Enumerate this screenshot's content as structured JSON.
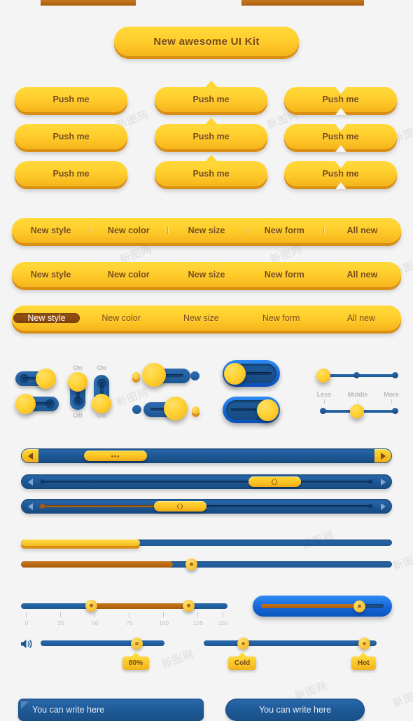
{
  "title": {
    "label": "New awesome UI Kit"
  },
  "push_buttons": {
    "label": "Push me",
    "rows": [
      [
        {
          "label": "Push me",
          "style": "plain"
        },
        {
          "label": "Push me",
          "style": "notch-top"
        },
        {
          "label": "Push me",
          "style": "split"
        }
      ],
      [
        {
          "label": "Push me",
          "style": "plain"
        },
        {
          "label": "Push me",
          "style": "notch-top"
        },
        {
          "label": "Push me",
          "style": "split"
        }
      ],
      [
        {
          "label": "Push me",
          "style": "plain"
        },
        {
          "label": "Push me",
          "style": "notch-top"
        },
        {
          "label": "Push me",
          "style": "split"
        }
      ]
    ]
  },
  "tabbars": [
    {
      "style": "divided",
      "tabs": [
        "New style",
        "New color",
        "New size",
        "New form",
        "All new"
      ],
      "active": -1
    },
    {
      "style": "dots",
      "tabs": [
        "New style",
        "New color",
        "New size",
        "New form",
        "All new"
      ],
      "active": -1
    },
    {
      "style": "pill",
      "tabs": [
        "New style",
        "New color",
        "New size",
        "New form",
        "All new"
      ],
      "active": 0
    }
  ],
  "toggles": {
    "vertical_labels": {
      "on": "On",
      "off": "Off"
    },
    "horizontal": [
      {
        "state": "on"
      },
      {
        "state": "off"
      }
    ],
    "vertical": [
      {
        "state": "up",
        "on": "On",
        "off": "Off"
      },
      {
        "state": "down",
        "on": "On",
        "off": "Off"
      }
    ],
    "dotted": [
      {
        "state": "on"
      },
      {
        "state": "off"
      }
    ],
    "capsule": [
      {
        "state": "off"
      },
      {
        "state": "on"
      }
    ]
  },
  "step_sliders": [
    {
      "labels": [
        "Less",
        "Middle",
        "More"
      ],
      "position": 0,
      "show_labels": false
    },
    {
      "labels": [
        "Less",
        "Middle",
        "More"
      ],
      "position": 1,
      "show_labels": true
    }
  ],
  "scrollbars": [
    {
      "arrow_left": "◀",
      "arrow_right": "▶",
      "thumb_glyph": "•••",
      "thumb_percent": 13,
      "thumb_width": 90,
      "ends": "gold"
    },
    {
      "arrow_left": "◁",
      "arrow_right": "▷",
      "thumb_glyph": "〈〉",
      "thumb_percent": 62,
      "thumb_width": 75,
      "ends": "flat",
      "filled": false
    },
    {
      "arrow_left": "◁",
      "arrow_right": "▷",
      "thumb_glyph": "〈〉",
      "thumb_percent": 36,
      "thumb_width": 75,
      "ends": "flat",
      "filled": true
    }
  ],
  "progress_bars": [
    {
      "percent": 32,
      "color": "#f3bb22",
      "knob": false
    },
    {
      "percent": 41,
      "color": "#a85c0d",
      "knob": true
    }
  ],
  "ruler_slider": {
    "ticks": [
      "0",
      "25",
      "50",
      "75",
      "100",
      "125",
      "150"
    ],
    "min": 0,
    "max": 150,
    "handles": [
      50,
      125
    ]
  },
  "inset_slider": {
    "percent": 78
  },
  "volume_slider": {
    "icon": "speaker-icon",
    "percent": 70,
    "tooltip": "80%"
  },
  "temperature_slider": {
    "low_tooltip": "Cold",
    "high_tooltip": "Hot",
    "low_percent": 19,
    "high_percent": 84
  },
  "text_inputs": [
    {
      "placeholder": "You can write here",
      "corner": true
    },
    {
      "placeholder": "You can write here",
      "corner": false
    }
  ],
  "watermarks": [
    "新图网",
    "新图网",
    "新图网",
    "新图网",
    "新图网",
    "新图网",
    "新图网",
    "新图网"
  ],
  "colors": {
    "background": "#f4f4f4",
    "gold": "#ffd233",
    "gold_dark": "#f2ad18",
    "gold_shadow": "#d98e14",
    "brown_text": "#7a4a10",
    "blue": "#1d5793",
    "blue_bright": "#1565d8",
    "orange_fill": "#a85c0d",
    "label_gray": "#b9b9b9"
  }
}
